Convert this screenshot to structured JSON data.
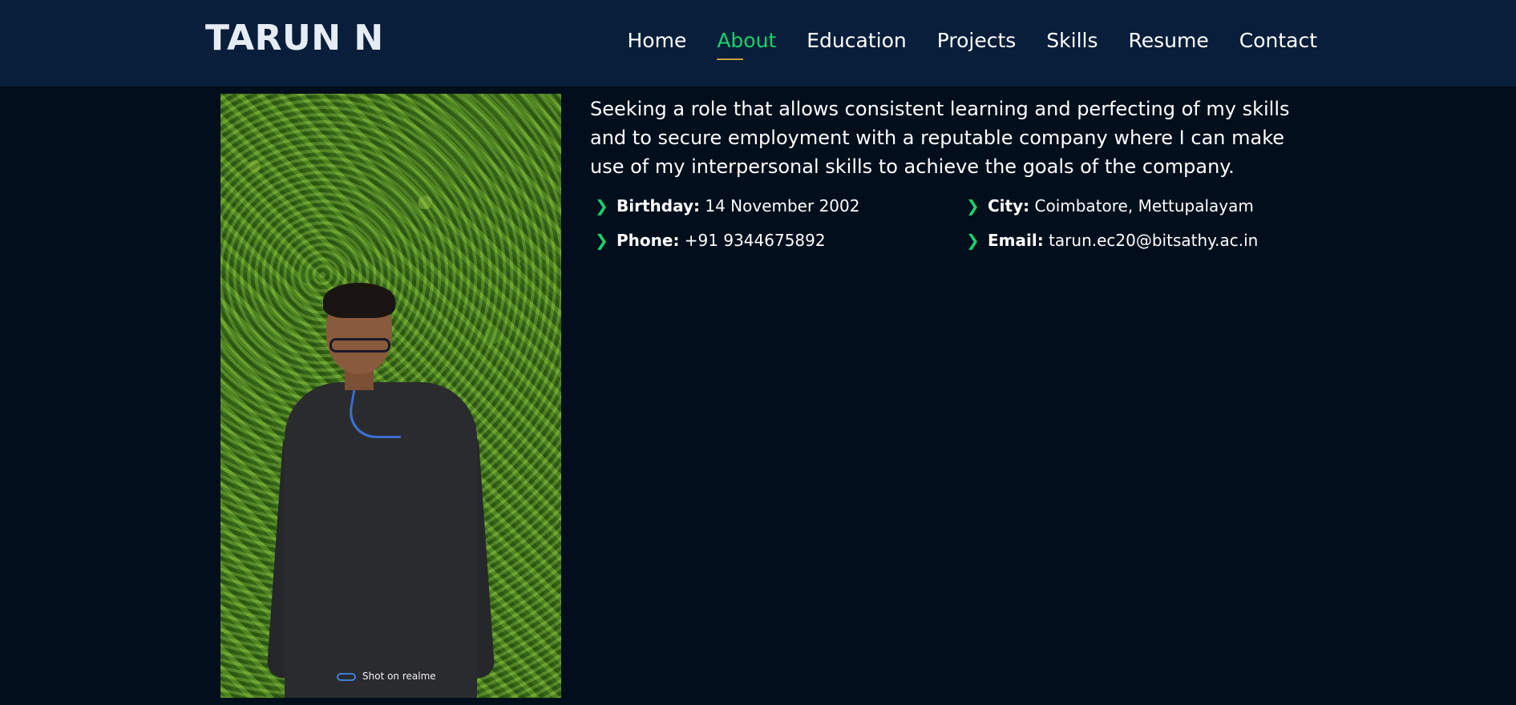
{
  "header": {
    "logo": "TARUN N",
    "nav": [
      {
        "label": "Home"
      },
      {
        "label": "About",
        "active": true
      },
      {
        "label": "Education"
      },
      {
        "label": "Projects"
      },
      {
        "label": "Skills"
      },
      {
        "label": "Resume"
      },
      {
        "label": "Contact"
      }
    ]
  },
  "about": {
    "photo_watermark": "Shot on realme",
    "summary": "Seeking a role that allows consistent learning and perfecting of my skills and to secure employment with a reputable company where I can make use of my interpersonal skills to achieve the goals of the company.",
    "details": [
      {
        "label": "Birthday:",
        "value": "14 November 2002"
      },
      {
        "label": "City:",
        "value": "Coimbatore, Mettupalayam"
      },
      {
        "label": "Phone:",
        "value": "+91 9344675892"
      },
      {
        "label": "Email:",
        "value": "tarun.ec20@bitsathy.ac.in"
      }
    ]
  },
  "colors": {
    "header_bg": "#081e3a",
    "page_bg": "#010e1b",
    "accent_green": "#18d26e",
    "active_underline": "#c7a036"
  },
  "icons": {
    "detail_bullet": "chevron-right-icon"
  }
}
